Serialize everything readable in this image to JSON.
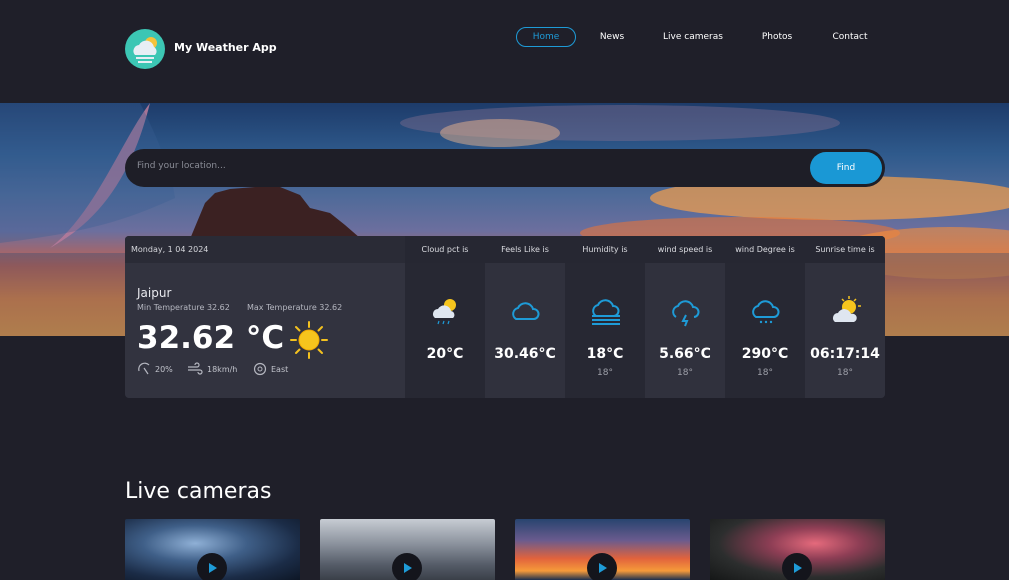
{
  "app": {
    "title": "My Weather App"
  },
  "nav": {
    "home": "Home",
    "news": "News",
    "live_cameras": "Live cameras",
    "photos": "Photos",
    "contact": "Contact"
  },
  "search": {
    "placeholder": "Find your location...",
    "button": "Find"
  },
  "current": {
    "date": "Monday, 1 04 2024",
    "city": "Jaipur",
    "min_temp": "Min Temperature 32.62",
    "max_temp": "Max Temperature 32.62",
    "temp": "32.62 °C",
    "humidity": "20%",
    "wind": "18km/h",
    "direction": "East"
  },
  "columns": [
    {
      "label": "Cloud pct is",
      "value": "20°C",
      "sub": ""
    },
    {
      "label": "Feels Like is",
      "value": "30.46°C",
      "sub": ""
    },
    {
      "label": "Humidity is",
      "value": "18°C",
      "sub": "18°"
    },
    {
      "label": "wind speed is",
      "value": "5.66°C",
      "sub": "18°"
    },
    {
      "label": "wind Degree is",
      "value": "290°C",
      "sub": "18°"
    },
    {
      "label": "Sunrise time is",
      "value": "06:17:14",
      "sub": "18°"
    }
  ],
  "live": {
    "title": "Live cameras"
  },
  "colors": {
    "accent": "#1a98d5",
    "background": "#1f1f29",
    "card": "#2b2c38"
  }
}
